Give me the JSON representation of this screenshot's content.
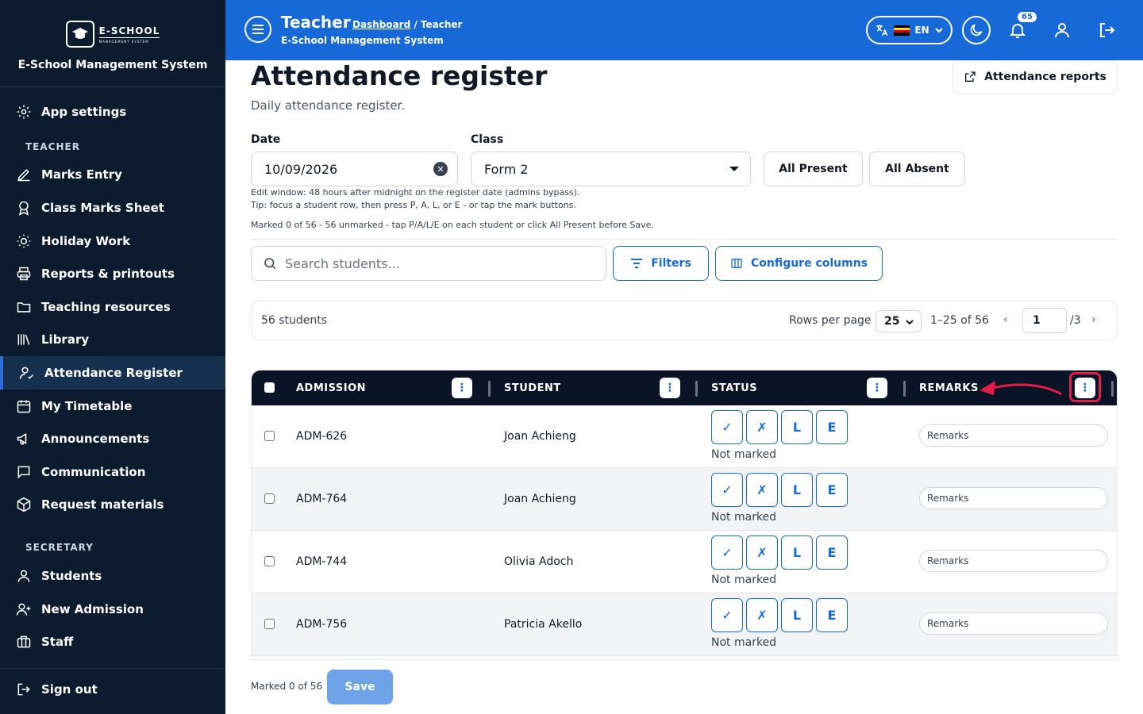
{
  "brand": {
    "logo_name": "E-SCHOOL",
    "logo_sub": "MANAGEMENT SYSTEM",
    "system_name": "E-School Management System"
  },
  "sidebar": {
    "top_items": [
      {
        "label": "App settings",
        "icon": "gear-icon"
      }
    ],
    "sections": [
      {
        "title": "TEACHER",
        "items": [
          {
            "label": "Marks Entry",
            "icon": "pencil-icon"
          },
          {
            "label": "Class Marks Sheet",
            "icon": "award-icon"
          },
          {
            "label": "Holiday Work",
            "icon": "sun-icon"
          },
          {
            "label": "Reports & printouts",
            "icon": "printer-icon"
          },
          {
            "label": "Teaching resources",
            "icon": "folder-icon"
          },
          {
            "label": "Library",
            "icon": "library-icon"
          },
          {
            "label": "Attendance Register",
            "icon": "user-check-icon",
            "active": true
          },
          {
            "label": "My Timetable",
            "icon": "calendar-icon"
          },
          {
            "label": "Announcements",
            "icon": "megaphone-icon"
          },
          {
            "label": "Communication",
            "icon": "message-icon"
          },
          {
            "label": "Request materials",
            "icon": "package-icon"
          }
        ]
      },
      {
        "title": "SECRETARY",
        "items": [
          {
            "label": "Students",
            "icon": "user-icon"
          },
          {
            "label": "New Admission",
            "icon": "user-plus-icon"
          },
          {
            "label": "Staff",
            "icon": "briefcase-icon"
          }
        ]
      }
    ],
    "sign_out": "Sign out"
  },
  "header": {
    "title": "Teacher",
    "breadcrumb_link": "Dashboard",
    "breadcrumb_rest": " / Teacher",
    "subtitle": "E-School Management System",
    "language": "EN",
    "notification_count": "65",
    "brand_color": "#1769d8"
  },
  "page": {
    "title": "Attendance register",
    "subtitle": "Daily attendance register.",
    "reports_button": "Attendance reports"
  },
  "form": {
    "date_label": "Date",
    "date_value": "10/09/2026",
    "class_label": "Class",
    "class_value": "Form 2",
    "all_present": "All Present",
    "all_absent": "All Absent",
    "hint_edit_window": "Edit window: 48 hours after midnight on the register date (admins bypass).",
    "hint_tip": "Tip: focus a student row, then press P, A, L, or E - or tap the mark buttons.",
    "marked_summary": "Marked 0 of 56 - 56 unmarked - tap P/A/L/E on each student or click All Present before Save."
  },
  "toolbar": {
    "search_placeholder": "Search students...",
    "filters": "Filters",
    "configure_columns": "Configure columns"
  },
  "pagination": {
    "count": "56 students",
    "rows_per_page_label": "Rows per page",
    "rows_per_page": "25",
    "range": "1–25 of 56",
    "page": "1",
    "total_pages": "/3"
  },
  "table": {
    "columns": [
      "ADMISSION",
      "STUDENT",
      "STATUS",
      "REMARKS"
    ],
    "mark_buttons": [
      "✓",
      "✗",
      "L",
      "E"
    ],
    "rows": [
      {
        "admission": "ADM-626",
        "student": "Joan Achieng",
        "status": "Not marked",
        "remarks_placeholder": "Remarks"
      },
      {
        "admission": "ADM-764",
        "student": "Joan Achieng",
        "status": "Not marked",
        "remarks_placeholder": "Remarks"
      },
      {
        "admission": "ADM-744",
        "student": "Olivia Adoch",
        "status": "Not marked",
        "remarks_placeholder": "Remarks"
      },
      {
        "admission": "ADM-756",
        "student": "Patricia Akello",
        "status": "Not marked",
        "remarks_placeholder": "Remarks"
      }
    ]
  },
  "footer": {
    "marked": "Marked 0 of 56",
    "save": "Save"
  },
  "annotation": {
    "highlight_color": "#e11d48"
  }
}
